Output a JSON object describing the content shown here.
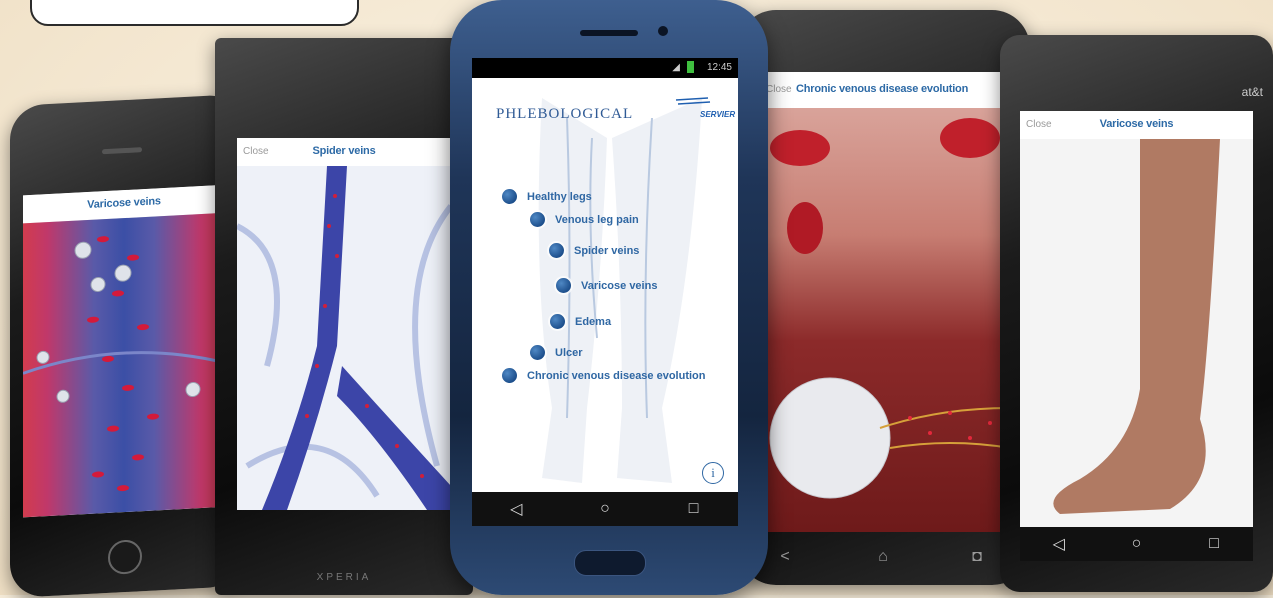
{
  "phones": {
    "iphone": {
      "title": "Varicose veins"
    },
    "sony": {
      "close": "Close",
      "title": "Spider veins",
      "brand": "XPERIA"
    },
    "galaxy": {
      "clock": "12:45",
      "app_name": "PHLEBOLOGICAL",
      "logo_text": "SERVIER",
      "menu": [
        {
          "label": "Healthy legs"
        },
        {
          "label": "Venous leg pain"
        },
        {
          "label": "Spider veins"
        },
        {
          "label": "Varicose veins"
        },
        {
          "label": "Edema"
        },
        {
          "label": "Ulcer"
        },
        {
          "label": "Chronic venous disease evolution"
        }
      ],
      "info_glyph": "i"
    },
    "htc": {
      "close": "Close",
      "title": "Chronic venous disease evolution"
    },
    "att": {
      "close": "Close",
      "title": "Varicose veins",
      "carrier": "at&t"
    }
  },
  "colors": {
    "accent": "#2f67a3",
    "dot": "#1d4f8c",
    "background": "#f6ecd9"
  },
  "icons": [
    "back-triangle-icon",
    "home-circle-icon",
    "recents-square-icon",
    "info-icon"
  ]
}
